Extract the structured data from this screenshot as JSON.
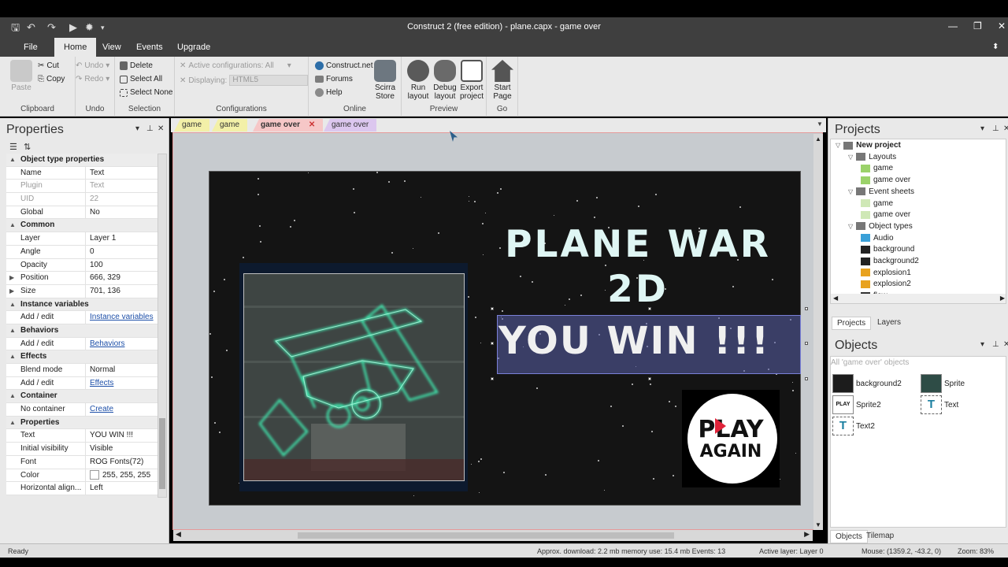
{
  "window": {
    "title": "Construct 2  (free edition) - plane.capx - game over",
    "controls": [
      "—",
      "❐",
      "✕"
    ]
  },
  "menu": {
    "items": [
      "File",
      "Home",
      "View",
      "Events",
      "Upgrade"
    ],
    "active": "Home"
  },
  "ribbon": {
    "clipboard": {
      "label": "Clipboard",
      "paste": "Paste",
      "cut": "Cut",
      "copy": "Copy"
    },
    "undo": {
      "label": "Undo",
      "undo": "Undo",
      "redo": "Redo"
    },
    "selection": {
      "label": "Selection",
      "delete": "Delete",
      "select_all": "Select All",
      "select_none": "Select None"
    },
    "configurations": {
      "label": "Configurations",
      "active": "Active configurations: All",
      "displaying": "Displaying:",
      "displaying_value": "HTML5"
    },
    "online": {
      "label": "Online",
      "construct": "Construct.net",
      "forums": "Forums",
      "help": "Help",
      "store_line1": "Scirra",
      "store_line2": "Store"
    },
    "preview": {
      "label": "Preview",
      "run1": "Run",
      "run2": "layout",
      "debug1": "Debug",
      "debug2": "layout",
      "export1": "Export",
      "export2": "project"
    },
    "go": {
      "label": "Go",
      "start1": "Start",
      "start2": "Page"
    }
  },
  "properties": {
    "title": "Properties",
    "sections": [
      {
        "name": "Object type properties",
        "rows": [
          {
            "k": "Name",
            "v": "Text"
          },
          {
            "k": "Plugin",
            "v": "Text",
            "dim": true
          },
          {
            "k": "UID",
            "v": "22",
            "dim": true
          },
          {
            "k": "Global",
            "v": "No"
          }
        ]
      },
      {
        "name": "Common",
        "rows": [
          {
            "k": "Layer",
            "v": "Layer 1"
          },
          {
            "k": "Angle",
            "v": "0"
          },
          {
            "k": "Opacity",
            "v": "100"
          },
          {
            "k": "Position",
            "v": "666, 329",
            "exp": true
          },
          {
            "k": "Size",
            "v": "701, 136",
            "exp": true
          }
        ]
      },
      {
        "name": "Instance variables",
        "rows": [
          {
            "k": "Add / edit",
            "v": "Instance variables",
            "link": true
          }
        ]
      },
      {
        "name": "Behaviors",
        "rows": [
          {
            "k": "Add / edit",
            "v": "Behaviors",
            "link": true
          }
        ]
      },
      {
        "name": "Effects",
        "rows": [
          {
            "k": "Blend mode",
            "v": "Normal"
          },
          {
            "k": "Add / edit",
            "v": "Effects",
            "link": true
          }
        ]
      },
      {
        "name": "Container",
        "rows": [
          {
            "k": "No container",
            "v": "Create",
            "link": true
          }
        ]
      },
      {
        "name": "Properties",
        "rows": [
          {
            "k": "Text",
            "v": "YOU WIN !!!"
          },
          {
            "k": "Initial visibility",
            "v": "Visible"
          },
          {
            "k": "Font",
            "v": "ROG Fonts(72)"
          },
          {
            "k": "Color",
            "v": "255, 255, 255",
            "swatch": true
          },
          {
            "k": "Horizontal align...",
            "v": "Left"
          }
        ]
      }
    ]
  },
  "editor_tabs": [
    {
      "label": "game",
      "color": "#f3f0a8"
    },
    {
      "label": "game",
      "color": "#f3f0a8"
    },
    {
      "label": "game over",
      "color": "#f6c7c7",
      "active": true,
      "close": "✕"
    },
    {
      "label": "game over",
      "color": "#dcc7ef"
    }
  ],
  "layout": {
    "title_line1": "PLANE WAR",
    "title_line2": "2D",
    "win_text": "YOU WIN !!!",
    "play_line1": "PLAY",
    "play_line2": "AGAIN"
  },
  "projects": {
    "title": "Projects",
    "tree": [
      {
        "label": "New project",
        "level": 0,
        "bold": true,
        "icon": "folder"
      },
      {
        "label": "Layouts",
        "level": 1,
        "icon": "folder"
      },
      {
        "label": "game",
        "level": 2,
        "icon": "layout"
      },
      {
        "label": "game over",
        "level": 2,
        "icon": "layout"
      },
      {
        "label": "Event sheets",
        "level": 1,
        "icon": "folder"
      },
      {
        "label": "game",
        "level": 2,
        "icon": "events"
      },
      {
        "label": "game over",
        "level": 2,
        "icon": "events"
      },
      {
        "label": "Object types",
        "level": 1,
        "icon": "folder"
      },
      {
        "label": "Audio",
        "level": 2,
        "icon": "audio"
      },
      {
        "label": "background",
        "level": 2,
        "icon": "dark"
      },
      {
        "label": "background2",
        "level": 2,
        "icon": "dark"
      },
      {
        "label": "explosion1",
        "level": 2,
        "icon": "explosion"
      },
      {
        "label": "explosion2",
        "level": 2,
        "icon": "explosion"
      },
      {
        "label": "flow",
        "level": 2,
        "icon": "cross"
      }
    ],
    "tabs": [
      "Projects",
      "Layers"
    ]
  },
  "objects": {
    "title": "Objects",
    "filter_placeholder": "All 'game over' objects",
    "items": [
      {
        "label": "background2",
        "icon": "dark"
      },
      {
        "label": "Sprite",
        "icon": "sprite"
      },
      {
        "label": "Sprite2",
        "icon": "play"
      },
      {
        "label": "Text",
        "icon": "text"
      },
      {
        "label": "Text2",
        "icon": "text"
      }
    ],
    "tabs": [
      "Objects",
      "Tilemap"
    ]
  },
  "status": {
    "ready": "Ready",
    "download": "Approx. download: 2.2 mb  memory use: 15.4 mb  Events: 13",
    "layer": "Active layer: Layer 0",
    "mouse": "Mouse: (1359.2, -43.2, 0)",
    "zoom": "Zoom: 83%"
  }
}
